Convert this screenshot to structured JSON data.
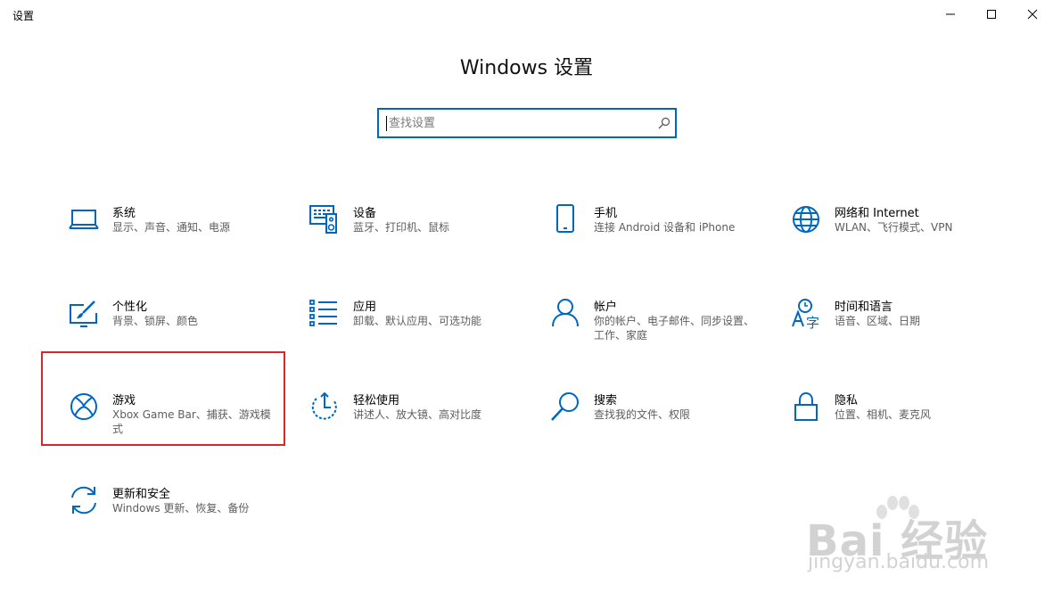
{
  "window": {
    "title": "设置"
  },
  "header": {
    "title": "Windows 设置"
  },
  "search": {
    "placeholder": "查找设置"
  },
  "tiles": [
    {
      "title": "系统",
      "desc": "显示、声音、通知、电源",
      "icon": "laptop-icon"
    },
    {
      "title": "设备",
      "desc": "蓝牙、打印机、鼠标",
      "icon": "devices-icon"
    },
    {
      "title": "手机",
      "desc": "连接 Android 设备和 iPhone",
      "icon": "phone-icon"
    },
    {
      "title": "网络和 Internet",
      "desc": "WLAN、飞行模式、VPN",
      "icon": "globe-icon"
    },
    {
      "title": "个性化",
      "desc": "背景、锁屏、颜色",
      "icon": "personalization-icon"
    },
    {
      "title": "应用",
      "desc": "卸载、默认应用、可选功能",
      "icon": "apps-list-icon"
    },
    {
      "title": "帐户",
      "desc": "你的帐户、电子邮件、同步设置、工作、家庭",
      "icon": "person-icon"
    },
    {
      "title": "时间和语言",
      "desc": "语音、区域、日期",
      "icon": "time-language-icon"
    },
    {
      "title": "游戏",
      "desc": "Xbox Game Bar、捕获、游戏模式",
      "icon": "xbox-icon"
    },
    {
      "title": "轻松使用",
      "desc": "讲述人、放大镜、高对比度",
      "icon": "ease-of-access-icon"
    },
    {
      "title": "搜索",
      "desc": "查找我的文件、权限",
      "icon": "search-icon"
    },
    {
      "title": "隐私",
      "desc": "位置、相机、麦克风",
      "icon": "lock-icon"
    },
    {
      "title": "更新和安全",
      "desc": "Windows 更新、恢复、备份",
      "icon": "update-icon"
    }
  ],
  "watermark": {
    "logo": "Bai 经验",
    "url": "jingyan.baidu.com"
  },
  "colors": {
    "accent": "#0067c0",
    "highlight": "#d62828"
  }
}
